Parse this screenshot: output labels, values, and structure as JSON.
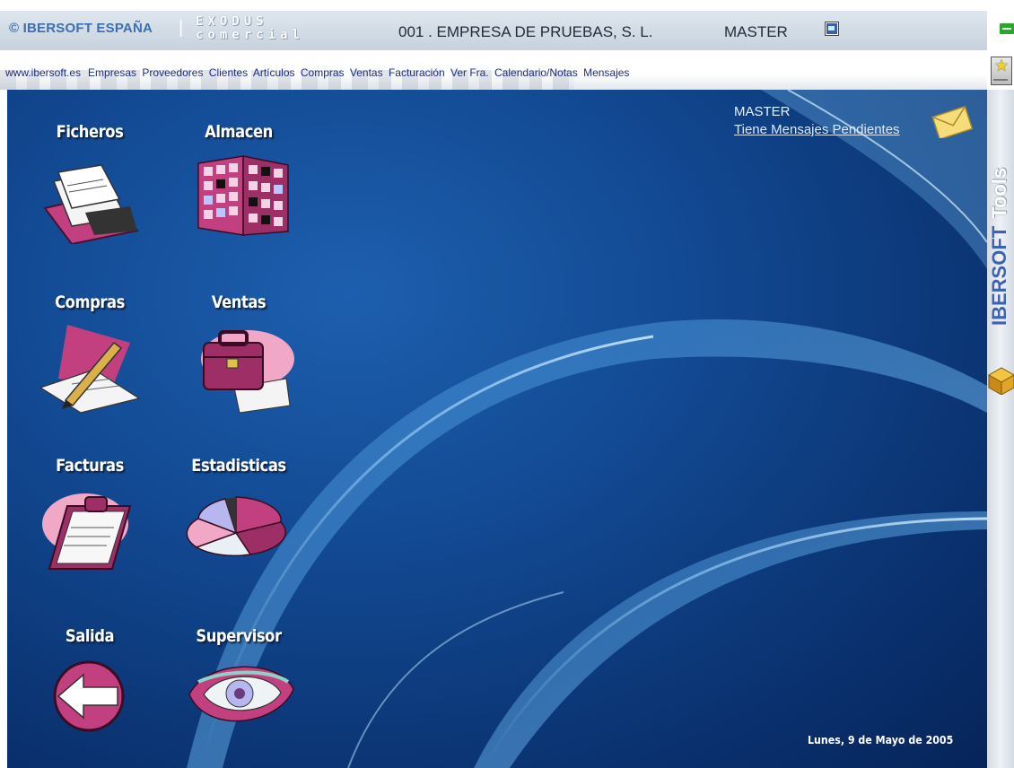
{
  "header": {
    "brand": "© IBERSOFT ESPAÑA",
    "separator": "|",
    "product_line1": "EXODUS",
    "product_line2": "comercial",
    "company": "001 . EMPRESA DE PRUEBAS, S. L.",
    "user": "MASTER"
  },
  "nav": {
    "site": "www.ibersoft.es",
    "links": [
      "Empresas",
      "Proveedores",
      "Clientes",
      "Artículos",
      "Compras",
      "Ventas",
      "Facturación",
      "Ver Fra.",
      "Calendario/Notas",
      "Mensajes"
    ]
  },
  "tiles": {
    "ficheros": "Ficheros",
    "almacen": "Almacen",
    "compras": "Compras",
    "ventas": "Ventas",
    "facturas": "Facturas",
    "estadisticas": "Estadisticas",
    "salida": "Salida",
    "supervisor": "Supervisor"
  },
  "messages": {
    "user": "MASTER",
    "pending": "Tiene Mensajes Pendientes"
  },
  "date": "Lunes,  9 de Mayo de 2005",
  "side_panel": {
    "brand": "IBERSOFT",
    "label": "Tools"
  },
  "colors": {
    "background": "#134b95",
    "accent_pink": "#c2407f",
    "nav_link": "#1a2c88",
    "brand_blue": "#3a6fb0"
  }
}
